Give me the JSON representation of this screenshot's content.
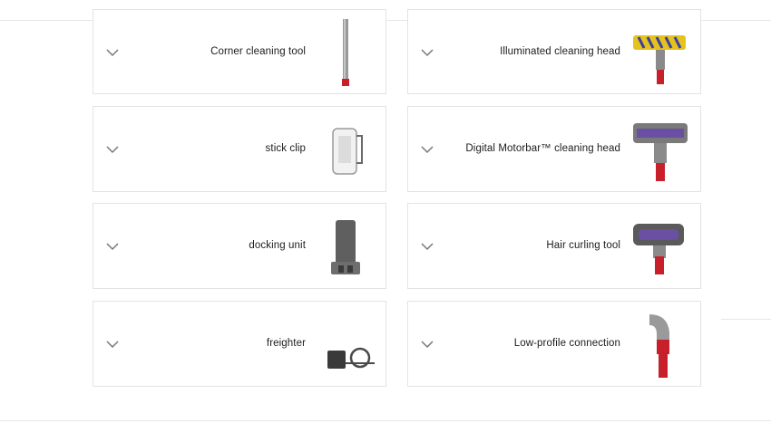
{
  "accessories": [
    {
      "label": "Corner cleaning tool",
      "icon": "corner-cleaning-tool-image"
    },
    {
      "label": "Illuminated cleaning head",
      "icon": "illuminated-cleaning-head-image"
    },
    {
      "label": "stick clip",
      "icon": "stick-clip-image"
    },
    {
      "label": "Digital Motorbar™ cleaning head",
      "icon": "digital-motorbar-cleaning-head-image"
    },
    {
      "label": "docking unit",
      "icon": "docking-unit-image"
    },
    {
      "label": "Hair curling tool",
      "icon": "hair-curling-tool-image"
    },
    {
      "label": "freighter",
      "icon": "freighter-image"
    },
    {
      "label": "Low-profile connection",
      "icon": "low-profile-connection-image"
    }
  ],
  "colors": {
    "border": "#e3e3e3",
    "chevron": "#777777",
    "dyson_red": "#c8202a",
    "dyson_purple": "#6a4fa3",
    "dyson_yellow": "#e6c21f",
    "metal_grey": "#8a8a8a"
  }
}
